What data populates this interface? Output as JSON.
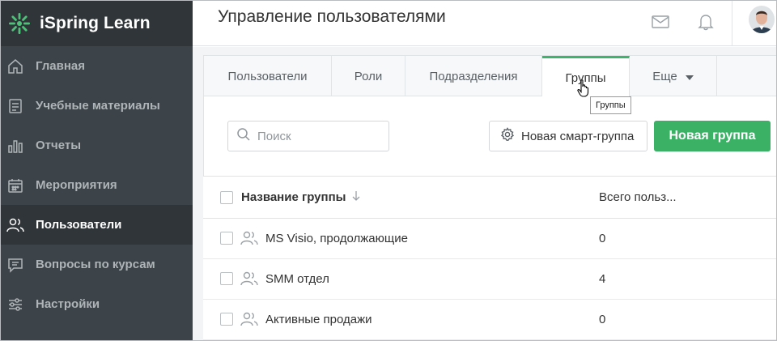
{
  "app": {
    "name": "iSpring Learn"
  },
  "sidebar": {
    "items": [
      {
        "label": "Главная",
        "icon": "home-icon",
        "active": false
      },
      {
        "label": "Учебные материалы",
        "icon": "materials-icon",
        "active": false
      },
      {
        "label": "Отчеты",
        "icon": "reports-icon",
        "active": false
      },
      {
        "label": "Мероприятия",
        "icon": "calendar-icon",
        "active": false
      },
      {
        "label": "Пользователи",
        "icon": "users-icon",
        "active": true
      },
      {
        "label": "Вопросы по курсам",
        "icon": "chat-icon",
        "active": false
      },
      {
        "label": "Настройки",
        "icon": "settings-icon",
        "active": false
      }
    ]
  },
  "header": {
    "title": "Управление пользователями",
    "icons": [
      "mail-icon",
      "bell-icon",
      "avatar"
    ]
  },
  "tabs": [
    {
      "label": "Пользователи",
      "active": false
    },
    {
      "label": "Роли",
      "active": false
    },
    {
      "label": "Подразделения",
      "active": false
    },
    {
      "label": "Группы",
      "active": true
    },
    {
      "label": "Еще",
      "active": false,
      "dropdown": true
    }
  ],
  "tooltip": {
    "text": "Группы"
  },
  "toolbar": {
    "search_placeholder": "Поиск",
    "smart_group_label": "Новая смарт-группа",
    "new_group_label": "Новая группа"
  },
  "table": {
    "columns": [
      "Название группы",
      "Всего польз..."
    ],
    "rows": [
      {
        "name": "MS Visio, продолжающие",
        "total": "0"
      },
      {
        "name": "SMM отдел",
        "total": "4"
      },
      {
        "name": "Активные продажи",
        "total": "0"
      }
    ]
  },
  "colors": {
    "accent": "#3bb166",
    "sidebar_bg": "#3d4449",
    "sidebar_active": "#2f3539"
  }
}
